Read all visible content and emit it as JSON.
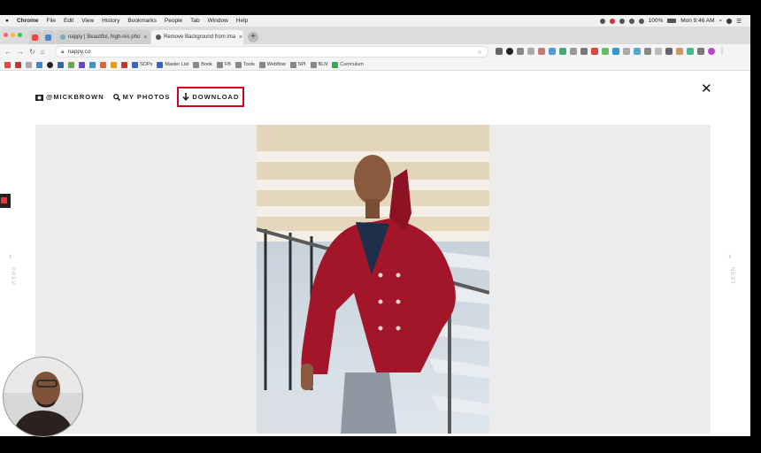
{
  "menubar": {
    "apple": "",
    "app": "Chrome",
    "items": [
      "File",
      "Edit",
      "View",
      "History",
      "Bookmarks",
      "People",
      "Tab",
      "Window",
      "Help"
    ],
    "battery": "100%",
    "clock": "Mon 9:46 AM"
  },
  "tabs": [
    {
      "title": "nappy | Beautiful, high-res pho",
      "active": false
    },
    {
      "title": "Remove Background from ima",
      "active": true
    }
  ],
  "address": {
    "url": "nappy.co"
  },
  "bookmarks": [
    "SOPs",
    "Master List",
    "Book",
    "FB",
    "Tools",
    "Webflow",
    "SPI",
    "BLN",
    "Curriculum"
  ],
  "nav": {
    "user": "@MICKBROWN",
    "photos": "MY PHOTOS",
    "download": "DOWNLOAD",
    "close": "✕",
    "prev": "PREV",
    "next": "NEXT"
  },
  "colors": {
    "highlight": "#d0021b",
    "coat": "#a3162a"
  }
}
